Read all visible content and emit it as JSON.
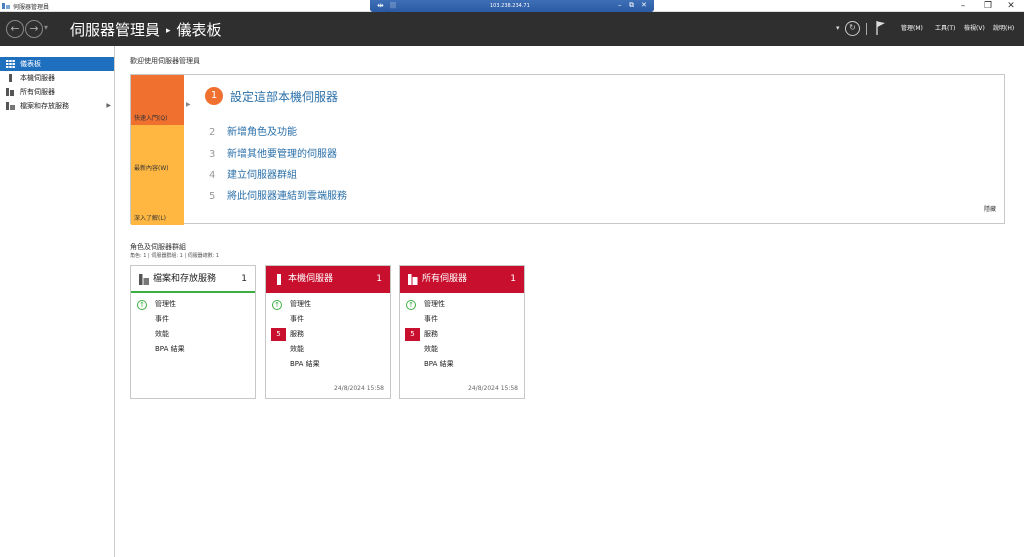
{
  "window": {
    "title": "伺服器管理員",
    "minimize": "–",
    "restore": "❐",
    "close": "✕"
  },
  "rdp": {
    "ip": "103.238.234.71",
    "pin": "⇹",
    "signal": "|||",
    "min": "–",
    "restore": "⧉",
    "close": "✕"
  },
  "header": {
    "back": "←",
    "forward": "→",
    "dropdown": "▾",
    "app_name": "伺服器管理員",
    "separator": "▸",
    "page": "儀表板",
    "refresh": "↻",
    "menus": [
      "管理(M)",
      "工具(T)",
      "檢視(V)",
      "說明(H)"
    ]
  },
  "sidebar": {
    "items": [
      {
        "label": "儀表板",
        "icon": "dashboard-icon"
      },
      {
        "label": "本機伺服器",
        "icon": "server-icon"
      },
      {
        "label": "所有伺服器",
        "icon": "servers-icon"
      },
      {
        "label": "檔案和存放服務",
        "icon": "storage-icon",
        "arrow": "▶"
      }
    ]
  },
  "welcome": {
    "title": "歡迎使用伺服器管理員",
    "tabs": [
      "快速入門(Q)",
      "最新內容(W)",
      "深入了解(L)"
    ],
    "tab_arrow": "▶",
    "step1_num": "1",
    "step1_text": "設定這部本機伺服器",
    "steps": [
      {
        "num": "2",
        "text": "新增角色及功能"
      },
      {
        "num": "3",
        "text": "新增其他要管理的伺服器"
      },
      {
        "num": "4",
        "text": "建立伺服器群組"
      },
      {
        "num": "5",
        "text": "將此伺服器連結到雲端服務"
      }
    ],
    "hide": "隱藏"
  },
  "roles": {
    "title": "角色及伺服器群組",
    "subtitle": "角色: 1 | 伺服器群組: 1 | 伺服器總數: 1",
    "tiles": [
      {
        "title": "檔案和存放服務",
        "count": "1",
        "rows": [
          {
            "label": "管理性",
            "status": "ok"
          },
          {
            "label": "事件"
          },
          {
            "label": "效能"
          },
          {
            "label": "BPA 結果"
          }
        ],
        "timestamp": ""
      },
      {
        "title": "本機伺服器",
        "count": "1",
        "rows": [
          {
            "label": "管理性",
            "status": "ok"
          },
          {
            "label": "事件"
          },
          {
            "label": "服務",
            "badge": "5"
          },
          {
            "label": "效能"
          },
          {
            "label": "BPA 結果"
          }
        ],
        "timestamp": "24/8/2024 15:58"
      },
      {
        "title": "所有伺服器",
        "count": "1",
        "rows": [
          {
            "label": "管理性",
            "status": "ok"
          },
          {
            "label": "事件"
          },
          {
            "label": "服務",
            "badge": "5"
          },
          {
            "label": "效能"
          },
          {
            "label": "BPA 結果"
          }
        ],
        "timestamp": "24/8/2024 15:58"
      }
    ]
  },
  "colors": {
    "header_bg": "#2f2f2f",
    "accent_orange": "#f07030",
    "tab_yellow": "#ffb742",
    "alert_red": "#c8102e",
    "ok_green": "#3cb043",
    "link_blue": "#2a6fa8",
    "sidebar_active": "#1f6fbf"
  }
}
